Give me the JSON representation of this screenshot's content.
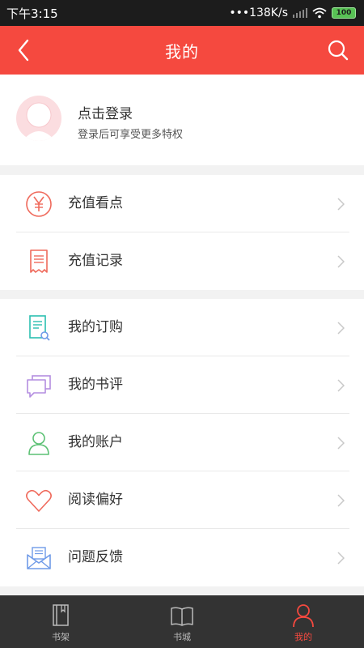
{
  "status_bar": {
    "time": "下午3:15",
    "speed": "•••138K/s",
    "battery": "100"
  },
  "header": {
    "title": "我的"
  },
  "profile": {
    "title": "点击登录",
    "subtitle": "登录后可享受更多特权"
  },
  "menu_group_1": [
    {
      "label": "充值看点",
      "icon": "yen-circle-icon"
    },
    {
      "label": "充值记录",
      "icon": "receipt-icon"
    }
  ],
  "menu_group_2": [
    {
      "label": "我的订购",
      "icon": "document-search-icon"
    },
    {
      "label": "我的书评",
      "icon": "chat-bubbles-icon"
    },
    {
      "label": "我的账户",
      "icon": "user-icon"
    },
    {
      "label": "阅读偏好",
      "icon": "heart-icon"
    },
    {
      "label": "问题反馈",
      "icon": "envelope-icon"
    }
  ],
  "bottom_nav": [
    {
      "label": "书架",
      "icon": "bookshelf-icon",
      "active": false
    },
    {
      "label": "书城",
      "icon": "open-book-icon",
      "active": false
    },
    {
      "label": "我的",
      "icon": "person-icon",
      "active": true
    }
  ],
  "colors": {
    "accent": "#f5493f",
    "icon_red": "#ef6a5c",
    "icon_teal": "#2bbfb0",
    "icon_purple": "#b48ee0",
    "icon_green": "#5cc174",
    "icon_blue": "#6f9be8",
    "nav_background": "#333333"
  }
}
